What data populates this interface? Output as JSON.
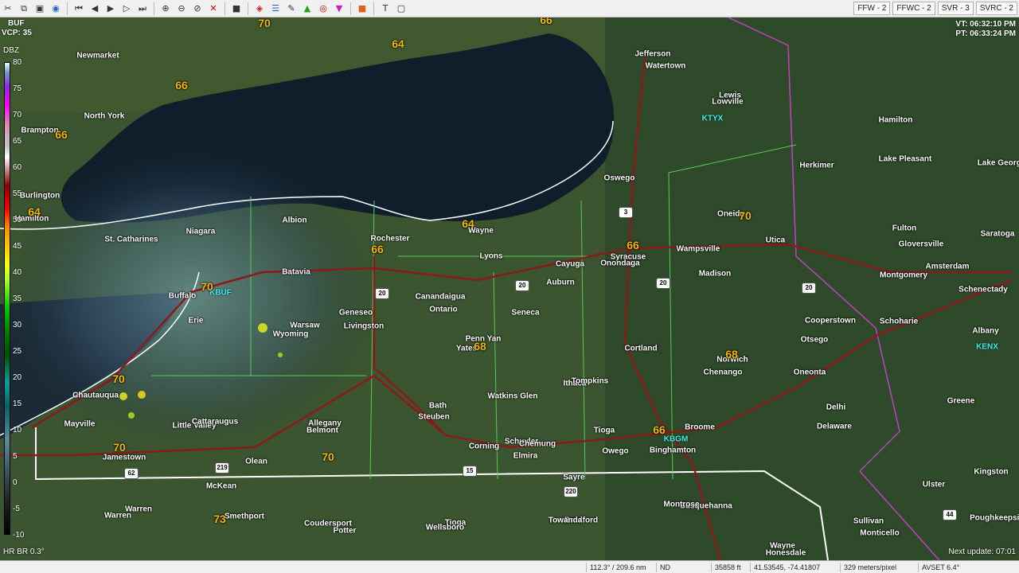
{
  "toolbar": {
    "warnings": [
      {
        "label": "FFW - 2"
      },
      {
        "label": "FFWC - 2"
      },
      {
        "label": "SVR - 3"
      },
      {
        "label": "SVRC - 2"
      }
    ]
  },
  "site": {
    "id": "BUF",
    "vcp": "VCP: 35",
    "tilt": "HR BR 0.3°"
  },
  "times": {
    "vt": "VT: 06:32:10 PM",
    "pt": "PT: 06:33:24 PM"
  },
  "legend": {
    "title": "DBZ",
    "ticks": [
      "80",
      "75",
      "70",
      "65",
      "60",
      "55",
      "50",
      "45",
      "40",
      "35",
      "30",
      "25",
      "20",
      "15",
      "10",
      "5",
      "0",
      "-5",
      "-10"
    ]
  },
  "next_update": "Next update: 07:01",
  "status": {
    "azimuth": "112.3° / 209.6 nm",
    "nd": "ND",
    "height": "35858 ft",
    "coords": "41.53545, -74.41807",
    "resolution": "329 meters/pixel",
    "avset": "AVSET 6.4°"
  },
  "radars": [
    {
      "id": "KBUF"
    },
    {
      "id": "KTYX"
    },
    {
      "id": "KBGM"
    },
    {
      "id": "KENX"
    }
  ],
  "places": [
    "Newmarket",
    "North York",
    "Brampton",
    "Burlington",
    "Hamilton",
    "St. Catharines",
    "Niagara",
    "Albion",
    "Rochester",
    "Wayne",
    "Lyons",
    "Batavia",
    "Buffalo",
    "Erie",
    "Warsaw",
    "Wyoming",
    "Geneseo",
    "Livingston",
    "Canandaigua",
    "Ontario",
    "Seneca",
    "Penn Yan",
    "Yates",
    "Chautauqua",
    "Mayville",
    "Little Valley",
    "Cattaraugus",
    "Jamestown",
    "Allegany",
    "Belmont",
    "Olean",
    "Bath",
    "Steuben",
    "Corning",
    "Schuyler",
    "Elmira",
    "Chemung",
    "Watkins Glen",
    "Ithaca",
    "Tompkins",
    "Tioga",
    "Owego",
    "Binghamton",
    "Broome",
    "Cortland",
    "Cayuga",
    "Auburn",
    "Syracuse",
    "Onondaga",
    "Oswego",
    "Wampsville",
    "Madison",
    "Norwich",
    "Chenango",
    "Oneonta",
    "Otsego",
    "Cooperstown",
    "Delhi",
    "Delaware",
    "Utica",
    "Oneida",
    "Herkimer",
    "Lewis",
    "Lowville",
    "Jefferson",
    "Watertown",
    "Hamilton",
    "Lake Pleasant",
    "Fulton",
    "Gloversville",
    "Montgomery",
    "Amsterdam",
    "Schenectady",
    "Schoharie",
    "Albany",
    "Greene",
    "Ulster",
    "Kingston",
    "Sullivan",
    "Monticello",
    "Wayne",
    "Honesdale",
    "Susquehanna",
    "Montrose",
    "Bradford",
    "Towanda",
    "Sayre",
    "Tioga",
    "Wellsboro",
    "Potter",
    "Coudersport",
    "McKean",
    "Smethport",
    "Warren",
    "Warren",
    "Saratoga",
    "Lake George",
    "Poughkeepsie"
  ],
  "temps": [
    "70",
    "66",
    "66",
    "64",
    "64",
    "66",
    "70",
    "70",
    "70",
    "68",
    "68",
    "70",
    "73",
    "66",
    "66",
    "66",
    "70",
    "64"
  ]
}
